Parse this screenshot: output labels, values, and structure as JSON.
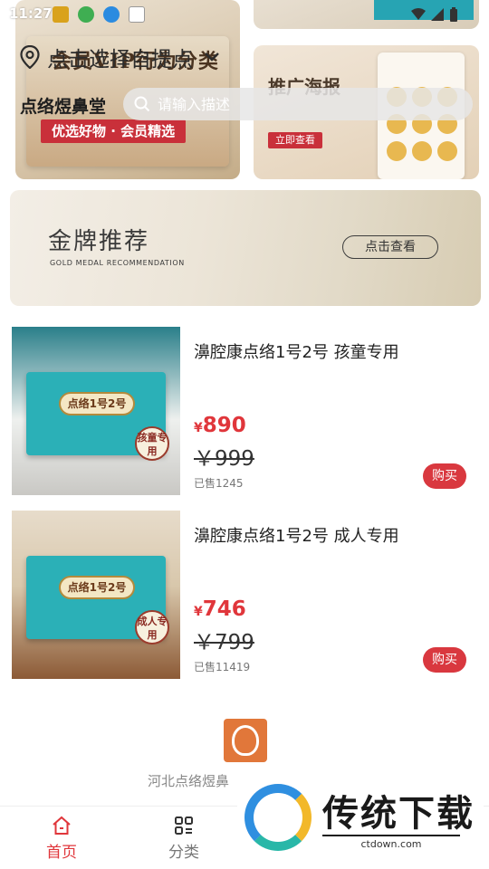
{
  "status_bar": {
    "time": "11:27"
  },
  "header": {
    "location_label": "点击选择自提点",
    "shop_name": "点络煜鼻堂",
    "search_placeholder": "请输入描述"
  },
  "banners": {
    "vip": {
      "title": "会员VIP行为分类",
      "subtitle": "优选好物 · 会员精选"
    },
    "poster": {
      "title": "推广海报",
      "button": "立即查看"
    }
  },
  "gold_banner": {
    "title": "金牌推荐",
    "subtitle_en": "GOLD MEDAL RECOMMENDATION",
    "button": "点击查看"
  },
  "products": [
    {
      "name": "濞腔康点络1号2号 孩童专用",
      "currency": "¥",
      "price": "890",
      "original_price": "￥999",
      "sold": "已售1245",
      "buy_label": "购买",
      "box_label": "点络1号2号",
      "tag": "孩童专用"
    },
    {
      "name": "濞腔康点络1号2号 成人专用",
      "currency": "¥",
      "price": "746",
      "original_price": "￥799",
      "sold": "已售11419",
      "buy_label": "购买",
      "box_label": "点络1号2号",
      "tag": "成人专用"
    }
  ],
  "footer": {
    "brand_text": "河北点络煜鼻"
  },
  "tabbar": {
    "home": "首页",
    "category": "分类"
  },
  "watermark": {
    "title": "传统下载",
    "url": "ctdown.com"
  },
  "colors": {
    "accent": "#e0363b",
    "search_bg": "#e6e6e6"
  }
}
